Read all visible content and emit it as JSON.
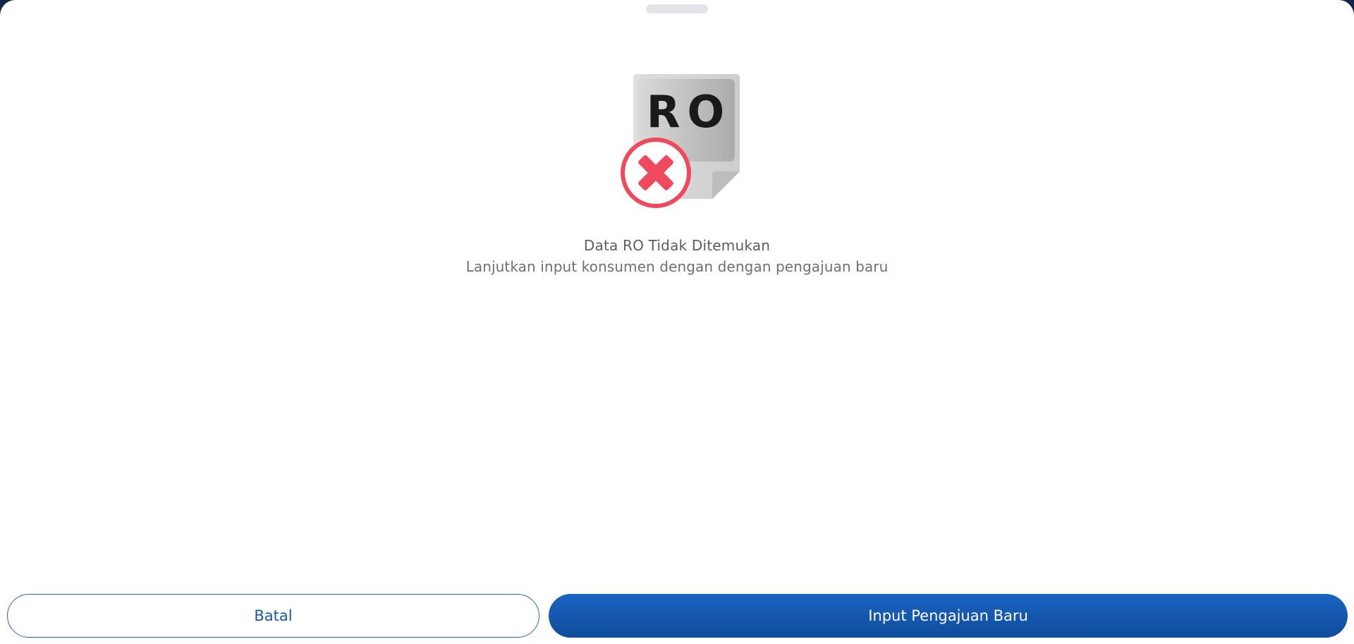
{
  "illustration": {
    "doc_text": "RO",
    "icon": "ro-not-found-icon",
    "colors": {
      "document": "#d6d6d6",
      "badge": "#f0485c",
      "text": "#1a1a1a"
    }
  },
  "message": {
    "title": "Data RO Tidak Ditemukan",
    "subtitle": "Lanjutkan input konsumen dengan dengan pengajuan baru"
  },
  "actions": {
    "cancel_label": "Batal",
    "primary_label": "Input Pengajuan Baru"
  },
  "colors": {
    "primary": "#1559b3",
    "backdrop": "#0d2747"
  }
}
